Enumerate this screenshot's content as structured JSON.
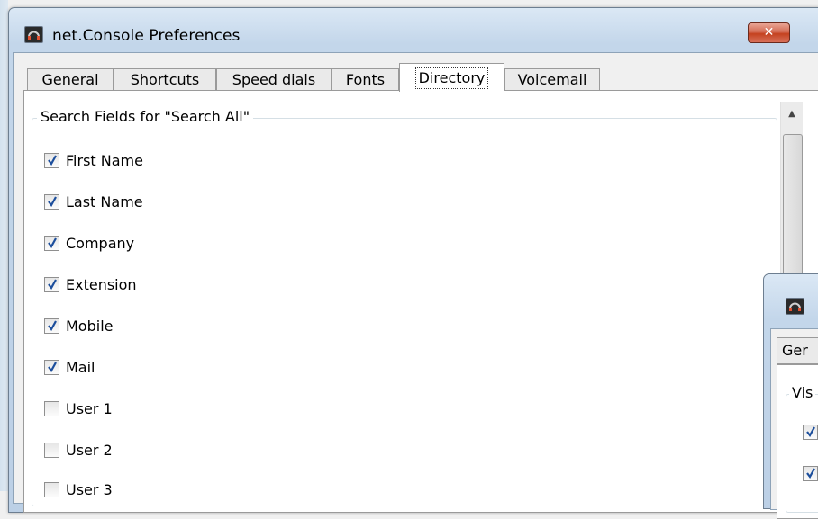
{
  "window": {
    "title": "net.Console Preferences",
    "close_label": "✕"
  },
  "tabs": [
    {
      "label": "General"
    },
    {
      "label": "Shortcuts"
    },
    {
      "label": "Speed dials"
    },
    {
      "label": "Fonts"
    },
    {
      "label": "Directory",
      "active": true
    },
    {
      "label": "Voicemail"
    }
  ],
  "search_fields": {
    "title": "Search Fields for \"Search All\"",
    "items": [
      {
        "label": "First Name",
        "checked": true
      },
      {
        "label": "Last Name",
        "checked": true
      },
      {
        "label": "Company",
        "checked": true
      },
      {
        "label": "Extension",
        "checked": true
      },
      {
        "label": "Mobile",
        "checked": true
      },
      {
        "label": "Mail",
        "checked": true
      },
      {
        "label": "User 1",
        "checked": false
      },
      {
        "label": "User 2",
        "checked": false
      },
      {
        "label": "User 3",
        "checked": false
      }
    ]
  },
  "second_window": {
    "tab_label": "Ger",
    "group_title": "Vis"
  }
}
